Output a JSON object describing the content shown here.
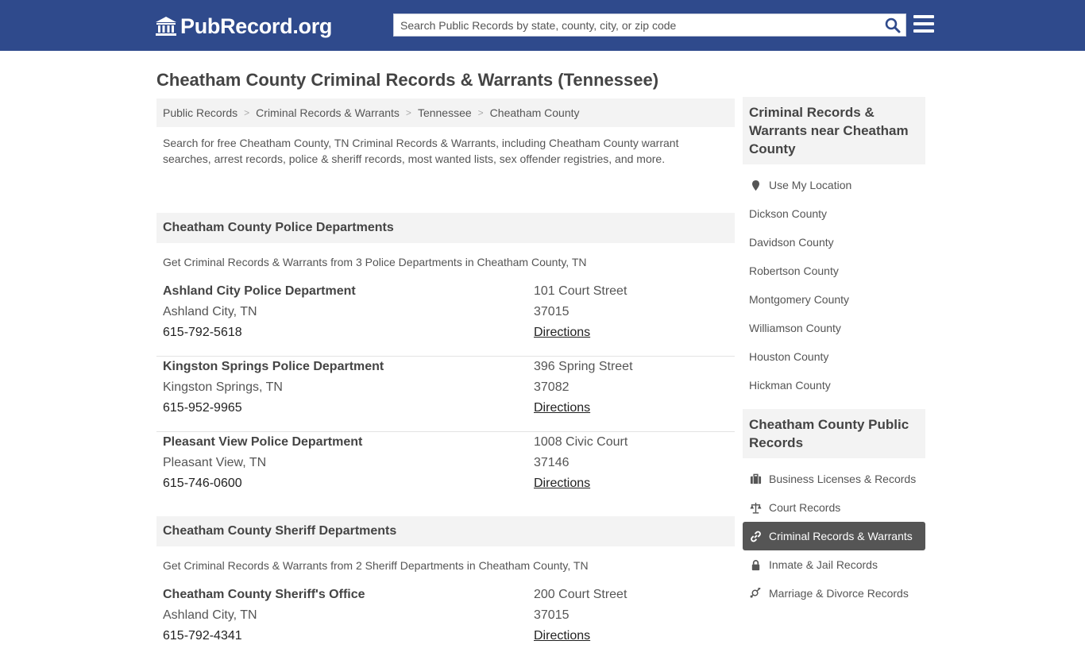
{
  "header": {
    "logo_text": "PubRecord.org",
    "search_placeholder": "Search Public Records by state, county, city, or zip code"
  },
  "page_title": "Cheatham County Criminal Records & Warrants (Tennessee)",
  "breadcrumb": [
    "Public Records",
    "Criminal Records & Warrants",
    "Tennessee",
    "Cheatham County"
  ],
  "intro": "Search for free Cheatham County, TN Criminal Records & Warrants, including Cheatham County warrant searches, arrest records, police & sheriff records, most wanted lists, sex offender registries, and more.",
  "police": {
    "title": "Cheatham County Police Departments",
    "subtitle": "Get Criminal Records & Warrants from 3 Police Departments in Cheatham County, TN",
    "entries": [
      {
        "name": "Ashland City Police Department",
        "city": "Ashland City, TN",
        "phone": "615-792-5618",
        "address": "101 Court Street",
        "zip": "37015",
        "directions": "Directions"
      },
      {
        "name": "Kingston Springs Police Department",
        "city": "Kingston Springs, TN",
        "phone": "615-952-9965",
        "address": "396 Spring Street",
        "zip": "37082",
        "directions": "Directions"
      },
      {
        "name": "Pleasant View Police Department",
        "city": "Pleasant View, TN",
        "phone": "615-746-0600",
        "address": "1008 Civic Court",
        "zip": "37146",
        "directions": "Directions"
      }
    ]
  },
  "sheriff": {
    "title": "Cheatham County Sheriff Departments",
    "subtitle": "Get Criminal Records & Warrants from 2 Sheriff Departments in Cheatham County, TN",
    "entries": [
      {
        "name": "Cheatham County Sheriff's Office",
        "city": "Ashland City, TN",
        "phone": "615-792-4341",
        "address": "200 Court Street",
        "zip": "37015",
        "directions": "Directions"
      }
    ]
  },
  "sidebar": {
    "nearby_title": "Criminal Records & Warrants near Cheatham County",
    "nearby": [
      "Use My Location",
      "Dickson County",
      "Davidson County",
      "Robertson County",
      "Montgomery County",
      "Williamson County",
      "Houston County",
      "Hickman County"
    ],
    "public_title": "Cheatham County Public Records",
    "public": [
      {
        "label": "Business Licenses & Records",
        "icon": "briefcase-icon"
      },
      {
        "label": "Court Records",
        "icon": "scales-icon"
      },
      {
        "label": "Criminal Records & Warrants",
        "icon": "link-icon",
        "active": true
      },
      {
        "label": "Inmate & Jail Records",
        "icon": "lock-icon"
      },
      {
        "label": "Marriage & Divorce Records",
        "icon": "gender-icon"
      }
    ]
  },
  "colors": {
    "header_bg": "#2f4a8c",
    "active_bg": "#555555",
    "panel_bg": "#f3f3f3"
  }
}
